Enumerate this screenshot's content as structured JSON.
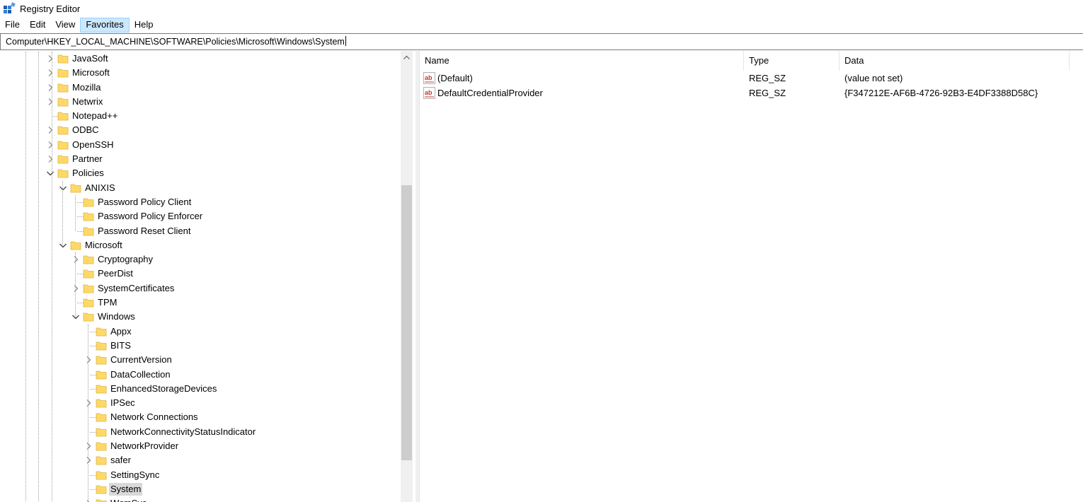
{
  "window": {
    "title": "Registry Editor",
    "icon": "registry-editor-icon"
  },
  "menu": {
    "items": [
      "File",
      "Edit",
      "View",
      "Favorites",
      "Help"
    ],
    "active": "Favorites"
  },
  "address": {
    "path": "Computer\\HKEY_LOCAL_MACHINE\\SOFTWARE\\Policies\\Microsoft\\Windows\\System"
  },
  "tree": {
    "nodes": [
      {
        "label": "JavaSoft",
        "level": 0,
        "expander": "collapsed"
      },
      {
        "label": "Microsoft",
        "level": 0,
        "expander": "collapsed"
      },
      {
        "label": "Mozilla",
        "level": 0,
        "expander": "collapsed"
      },
      {
        "label": "Netwrix",
        "level": 0,
        "expander": "collapsed"
      },
      {
        "label": "Notepad++",
        "level": 0,
        "expander": "none"
      },
      {
        "label": "ODBC",
        "level": 0,
        "expander": "collapsed"
      },
      {
        "label": "OpenSSH",
        "level": 0,
        "expander": "collapsed"
      },
      {
        "label": "Partner",
        "level": 0,
        "expander": "collapsed"
      },
      {
        "label": "Policies",
        "level": 0,
        "expander": "expanded"
      },
      {
        "label": "ANIXIS",
        "level": 1,
        "expander": "expanded"
      },
      {
        "label": "Password Policy Client",
        "level": 2,
        "expander": "none"
      },
      {
        "label": "Password Policy Enforcer",
        "level": 2,
        "expander": "none"
      },
      {
        "label": "Password Reset Client",
        "level": 2,
        "expander": "none"
      },
      {
        "label": "Microsoft",
        "level": 1,
        "expander": "expanded"
      },
      {
        "label": "Cryptography",
        "level": 2,
        "expander": "collapsed"
      },
      {
        "label": "PeerDist",
        "level": 2,
        "expander": "none"
      },
      {
        "label": "SystemCertificates",
        "level": 2,
        "expander": "collapsed"
      },
      {
        "label": "TPM",
        "level": 2,
        "expander": "none"
      },
      {
        "label": "Windows",
        "level": 2,
        "expander": "expanded"
      },
      {
        "label": "Appx",
        "level": 3,
        "expander": "none"
      },
      {
        "label": "BITS",
        "level": 3,
        "expander": "none"
      },
      {
        "label": "CurrentVersion",
        "level": 3,
        "expander": "collapsed"
      },
      {
        "label": "DataCollection",
        "level": 3,
        "expander": "none"
      },
      {
        "label": "EnhancedStorageDevices",
        "level": 3,
        "expander": "none"
      },
      {
        "label": "IPSec",
        "level": 3,
        "expander": "collapsed"
      },
      {
        "label": "Network Connections",
        "level": 3,
        "expander": "none"
      },
      {
        "label": "NetworkConnectivityStatusIndicator",
        "level": 3,
        "expander": "none"
      },
      {
        "label": "NetworkProvider",
        "level": 3,
        "expander": "collapsed"
      },
      {
        "label": "safer",
        "level": 3,
        "expander": "collapsed"
      },
      {
        "label": "SettingSync",
        "level": 3,
        "expander": "none"
      },
      {
        "label": "System",
        "level": 3,
        "expander": "none",
        "selected": true
      },
      {
        "label": "WcmSvc",
        "level": 3,
        "expander": "collapsed"
      }
    ]
  },
  "list": {
    "columns": [
      "Name",
      "Type",
      "Data"
    ],
    "rows": [
      {
        "icon": "string-value-icon",
        "name": "(Default)",
        "type": "REG_SZ",
        "data": "(value not set)"
      },
      {
        "icon": "string-value-icon",
        "name": "DefaultCredentialProvider",
        "type": "REG_SZ",
        "data": "{F347212E-AF6B-4726-92B3-E4DF3388D58C}"
      }
    ]
  },
  "colors": {
    "folder": "#ffd966",
    "folder_edge": "#dcb44a",
    "menu_active_bg": "#cce8ff",
    "selected_bg": "#d9d9d9",
    "scroll_thumb": "#cdcdcd"
  }
}
